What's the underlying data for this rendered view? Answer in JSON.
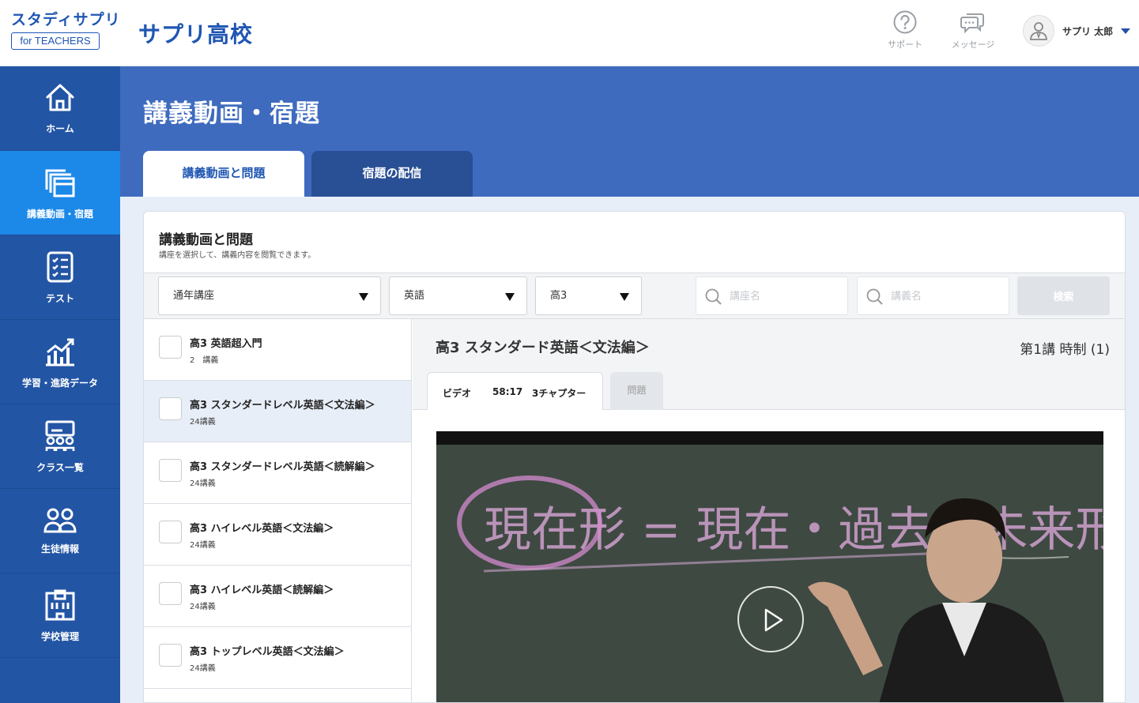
{
  "brand": {
    "logo_top": "スタディサプリ",
    "logo_bottom": "for TEACHERS",
    "school": "サプリ高校"
  },
  "header": {
    "support_label": "サポート",
    "message_label": "メッセージ",
    "user_name": "サプリ 太郎"
  },
  "sidebar": {
    "items": [
      {
        "label": "ホーム",
        "icon": "home-icon"
      },
      {
        "label": "講義動画・宿題",
        "icon": "lecture-video-icon",
        "active": true
      },
      {
        "label": "テスト",
        "icon": "test-checklist-icon"
      },
      {
        "label": "学習・進路データ",
        "icon": "chart-icon"
      },
      {
        "label": "クラス一覧",
        "icon": "class-icon"
      },
      {
        "label": "生徒情報",
        "icon": "students-icon"
      },
      {
        "label": "学校管理",
        "icon": "school-building-icon"
      }
    ]
  },
  "page": {
    "title": "講義動画・宿題",
    "tabs": [
      "講義動画と問題",
      "宿題の配信"
    ]
  },
  "panel": {
    "title": "講義動画と問題",
    "subtitle": "講座を選択して、講義内容を閲覧できます。"
  },
  "filters": {
    "course_type": "通年講座",
    "subject": "英語",
    "grade": "高3",
    "course_placeholder": "講座名",
    "lecture_placeholder": "講義名",
    "search_label": "検索"
  },
  "courses": [
    {
      "name": "高3 英語超入門",
      "count": "2　講義"
    },
    {
      "name": "高3 スタンダードレベル英語＜文法編＞",
      "count": "24講義"
    },
    {
      "name": "高3 スタンダードレベル英語＜読解編＞",
      "count": "24講義"
    },
    {
      "name": "高3 ハイレベル英語＜文法編＞",
      "count": "24講義"
    },
    {
      "name": "高3 ハイレベル英語＜読解編＞",
      "count": "24講義"
    },
    {
      "name": "高3 トップレベル英語＜文法編＞",
      "count": "24講義"
    }
  ],
  "detail": {
    "title": "高3 スタンダード英語＜文法編＞",
    "lesson": "第1講 時制 (1)",
    "video_tab": {
      "label": "ビデオ",
      "duration": "58:17",
      "chapters": "3チャプター"
    },
    "question_tab": "問題",
    "board_text": "現在形 = 現在・過去・未来形"
  },
  "colors": {
    "primary": "#2355a5",
    "active": "#1c88e8",
    "header_blue": "#3f6bbf"
  }
}
